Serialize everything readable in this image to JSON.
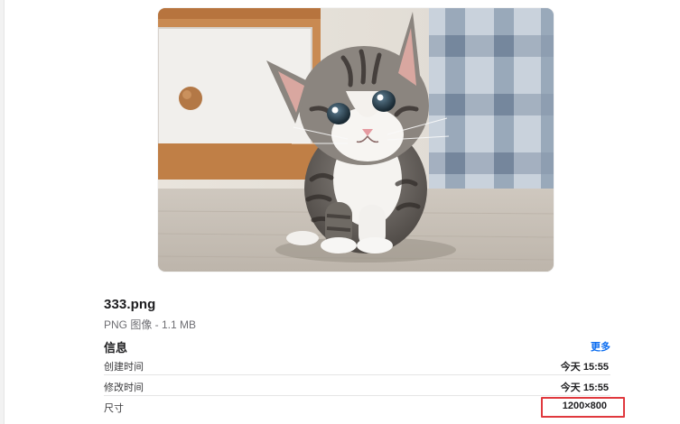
{
  "preview": {
    "description_icon": "kitten-photo"
  },
  "file": {
    "name": "333.png",
    "kind": "PNG 图像 - 1.1 MB"
  },
  "info": {
    "title": "信息",
    "more_label": "更多",
    "rows": [
      {
        "label": "创建时间",
        "value": "今天 15:55"
      },
      {
        "label": "修改时间",
        "value": "今天 15:55"
      },
      {
        "label": "尺寸",
        "value": "1200×800"
      }
    ]
  },
  "colors": {
    "accent_link": "#0a6cf0",
    "highlight": "#e0393e"
  }
}
